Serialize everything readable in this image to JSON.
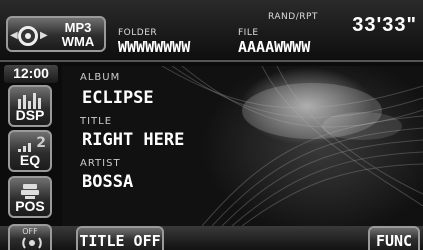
{
  "header": {
    "source_format_line1": "MP3",
    "source_format_line2": "WMA",
    "folder_label": "FOLDER",
    "folder_value": "WWWWWWWW",
    "file_label": "FILE",
    "file_value": "AAAAWWWW",
    "mode_label": "RAND/RPT",
    "elapsed_time": "33'33\""
  },
  "sidebar": {
    "clock": "12:00",
    "dsp_label": "DSP",
    "eq_label": "EQ",
    "eq_number": "2",
    "pos_label": "POS"
  },
  "track": {
    "album_label": "ALBUM",
    "album_value": "ECLIPSE",
    "title_label": "TITLE",
    "title_value": "RIGHT HERE",
    "artist_label": "ARTIST",
    "artist_value": "BOSSA"
  },
  "footer": {
    "off_label": "OFF",
    "title_off_label": "TITLE OFF",
    "func_label": "FUNC"
  },
  "icons": {
    "source": "disc-icon",
    "dsp": "equalizer-bars-icon",
    "eq": "eq-levels-icon",
    "pos": "seat-position-icon",
    "off": "surround-speaker-icon"
  }
}
